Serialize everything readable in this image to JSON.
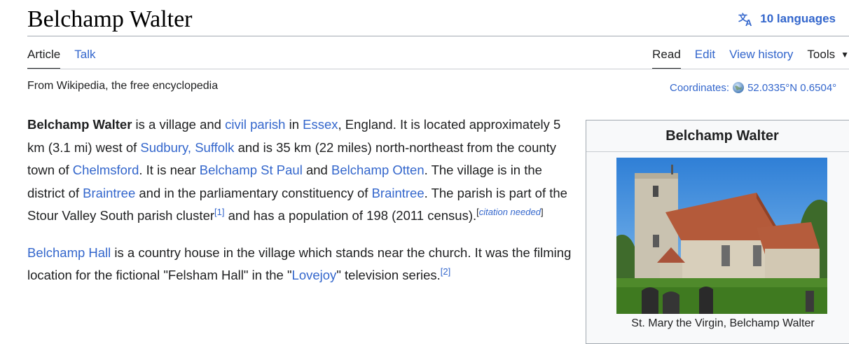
{
  "page": {
    "title": "Belchamp Walter",
    "languages": "10 languages",
    "tagline": "From Wikipedia, the free encyclopedia"
  },
  "tabs": {
    "left": [
      "Article",
      "Talk"
    ],
    "right": [
      "Read",
      "Edit",
      "View history",
      "Tools"
    ]
  },
  "coordinates": {
    "label": "Coordinates:",
    "value": "52.0335°N 0.6504°"
  },
  "article": {
    "p1": {
      "bold": "Belchamp Walter",
      "t1": " is a village and ",
      "l_civil_parish": "civil parish",
      "t2": " in ",
      "l_essex": "Essex",
      "t3": ", England. It is located approximately 5 km (3.1 mi) west of ",
      "l_sudbury": "Sudbury, Suffolk",
      "t4": " and is 35 km (22 miles) north-northeast from the county town of ",
      "l_chelmsford": "Chelmsford",
      "t5": ". It is near ",
      "l_stpaul": "Belchamp St Paul",
      "t6": " and ",
      "l_otten": "Belchamp Otten",
      "t7": ". The village is in the district of ",
      "l_braintree1": "Braintree",
      "t8": " and in the parliamentary constituency of ",
      "l_braintree2": "Braintree",
      "t9": ". The parish is part of the Stour Valley South parish cluster",
      "ref1": "[1]",
      "t10": " and has a population of 198 (2011 census).",
      "cn_open": "[",
      "cn_text": "citation needed",
      "cn_close": "]"
    },
    "p2": {
      "l_hall": "Belchamp Hall",
      "t1": " is a country house in the village which stands near the church. It was the filming location for the fictional \"Felsham Hall\" in the \"",
      "l_lovejoy": "Lovejoy",
      "t2": "\" television series.",
      "ref2": "[2]"
    }
  },
  "infobox": {
    "title": "Belchamp Walter",
    "caption": "St. Mary the Virgin, Belchamp Walter"
  },
  "colors": {
    "link": "#3366cc",
    "text": "#202122",
    "rule": "#a2a9b1"
  }
}
